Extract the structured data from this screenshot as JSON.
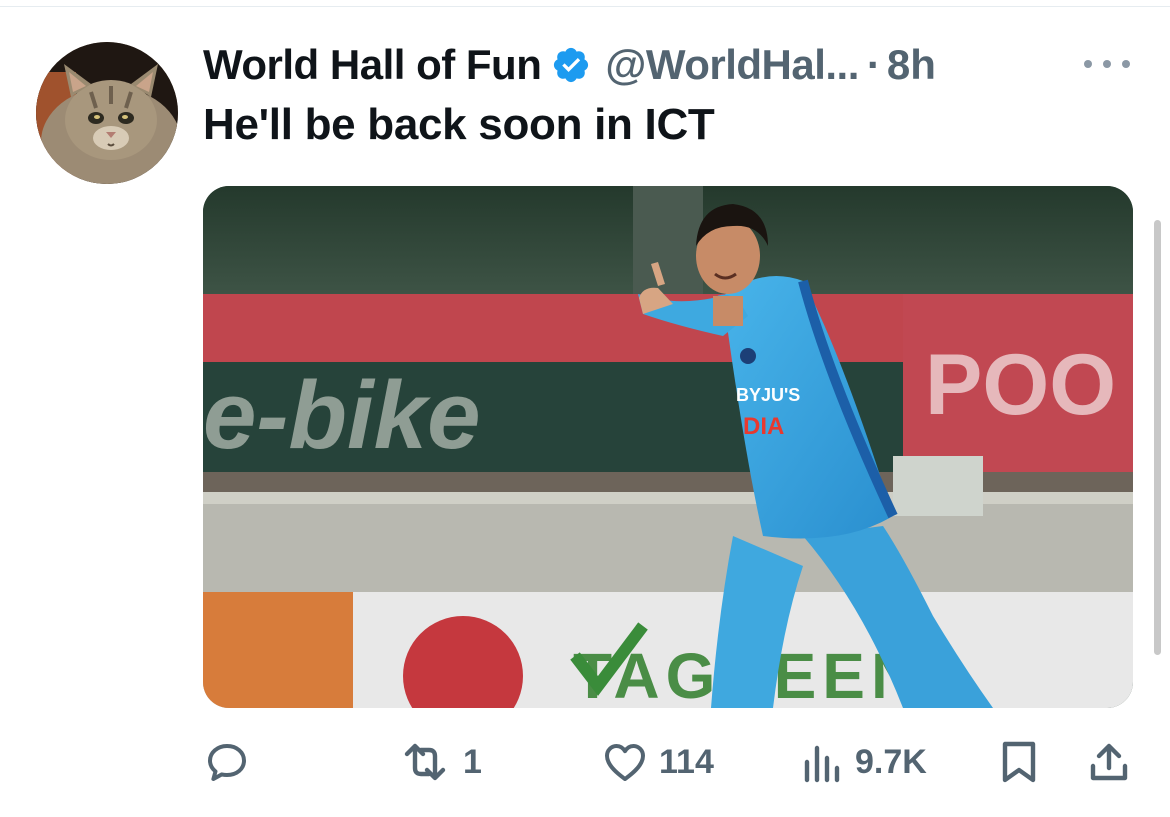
{
  "tweet": {
    "display_name": "World Hall of Fun",
    "verified": true,
    "handle": "@WorldHal...",
    "separator": "·",
    "time": "8h",
    "text": "He'll be back soon in ICT",
    "avatar": "cat-avatar",
    "media": {
      "banner_text_left": "e-bike",
      "banner_text_right": "POO",
      "bottom_board_text": "TAGREEN",
      "jersey_sponsor": "BYJU'S",
      "jersey_country": "DIA"
    }
  },
  "actions": {
    "reply": {
      "icon": "reply-icon",
      "count": ""
    },
    "retweet": {
      "icon": "retweet-icon",
      "count": "1"
    },
    "like": {
      "icon": "heart-icon",
      "count": "114"
    },
    "views": {
      "icon": "views-icon",
      "count": "9.7K"
    },
    "bookmark": {
      "icon": "bookmark-icon"
    },
    "share": {
      "icon": "share-icon"
    }
  },
  "colors": {
    "verified_blue": "#1d9bf0",
    "text_primary": "#0f1419",
    "text_secondary": "#536471",
    "jersey_blue": "#3aa5dd"
  }
}
